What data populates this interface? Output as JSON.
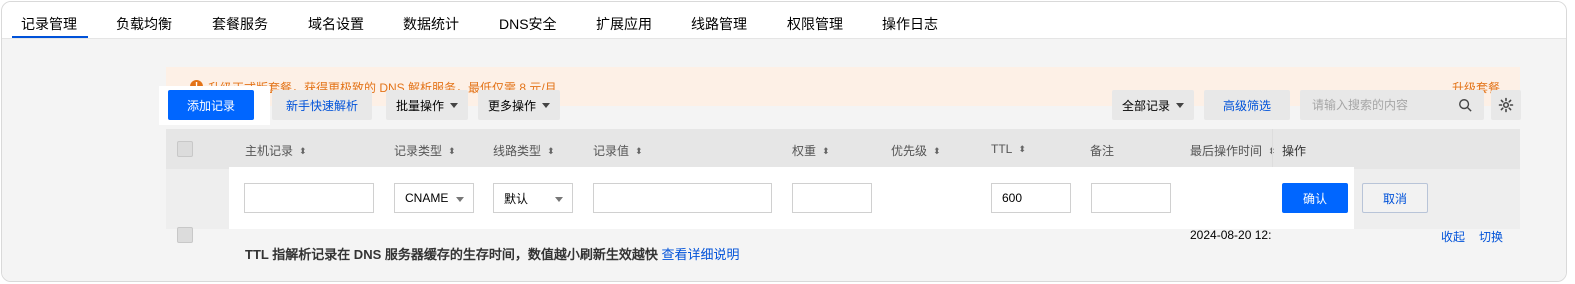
{
  "tabs": [
    {
      "label": "记录管理",
      "active": true
    },
    {
      "label": "负载均衡"
    },
    {
      "label": "套餐服务"
    },
    {
      "label": "域名设置"
    },
    {
      "label": "数据统计"
    },
    {
      "label": "DNS安全"
    },
    {
      "label": "扩展应用"
    },
    {
      "label": "线路管理"
    },
    {
      "label": "权限管理"
    },
    {
      "label": "操作日志"
    }
  ],
  "banner": {
    "icon": "!",
    "text": "升级正式版套餐，获得更极致的 DNS 解析服务，最低仅需 8 元/月",
    "action": "升级套餐"
  },
  "toolbar": {
    "add_record": "添加记录",
    "quick_guide": "新手快速解析",
    "batch": "批量操作",
    "more": "更多操作",
    "filter_all": "全部记录",
    "advanced_filter": "高级筛选",
    "search_placeholder": "请输入搜索的内容"
  },
  "columns": {
    "host": "主机记录",
    "type": "记录类型",
    "line": "线路类型",
    "value": "记录值",
    "weight": "权重",
    "priority": "优先级",
    "ttl": "TTL",
    "remark": "备注",
    "updated": "最后操作时间",
    "ops": "操作"
  },
  "edit_row": {
    "host": "",
    "type": "CNAME",
    "line": "默认",
    "value": "",
    "weight": "",
    "ttl": "600",
    "remark": "",
    "updated": "2024-08-20 12:",
    "confirm": "确认",
    "cancel": "取消",
    "collapse": "收起",
    "switch": "切换"
  },
  "footer": {
    "text": "TTL 指解析记录在 DNS 服务器缓存的生存时间，数值越小刷新生效越快",
    "link": "查看详细说明"
  },
  "colors": {
    "primary": "#0052d9",
    "primary_bright": "#0066ff",
    "warning": "#e37318",
    "warning_bg": "#fdf0e6"
  }
}
